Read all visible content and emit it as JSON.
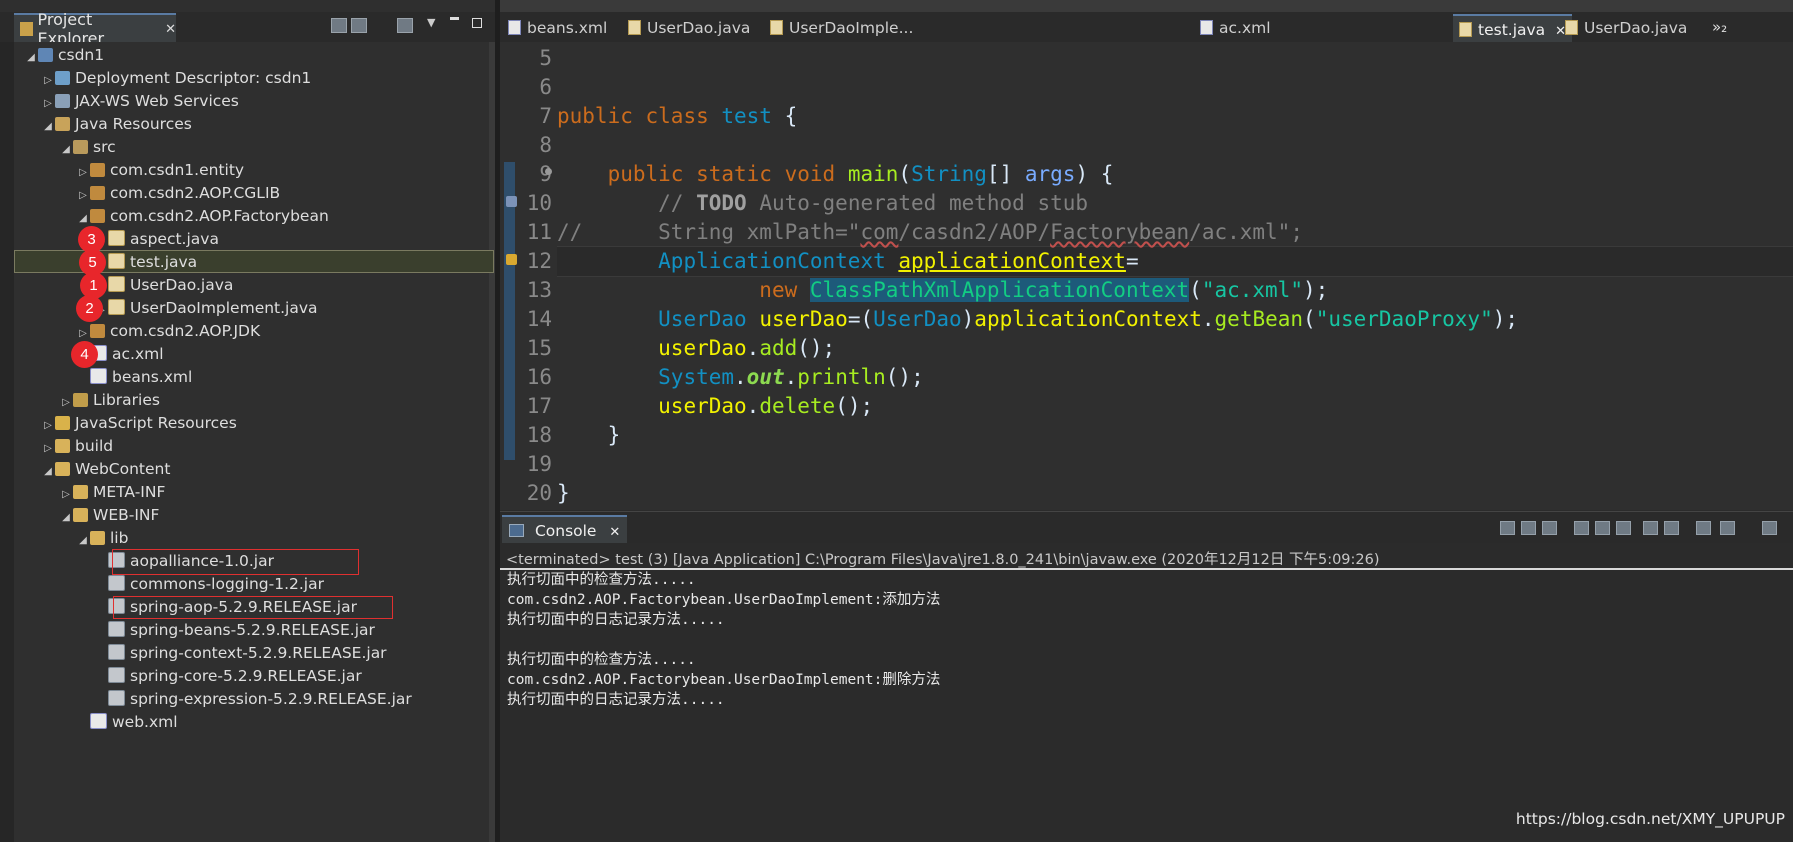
{
  "project_explorer": {
    "tab_label": "Project Explorer",
    "close_glyph": "✕",
    "tree": [
      {
        "label": "csdn1",
        "icon": "project-icon",
        "expand": "open",
        "badge": ""
      },
      {
        "label": "Deployment Descriptor: csdn1",
        "icon": "deployment-descriptor-icon",
        "expand": "closed",
        "badge": ""
      },
      {
        "label": "JAX-WS Web Services",
        "icon": "web-services-icon",
        "expand": "closed",
        "badge": ""
      },
      {
        "label": "Java Resources",
        "icon": "java-resources-icon",
        "expand": "open",
        "badge": ""
      },
      {
        "label": "src",
        "icon": "source-folder-icon",
        "expand": "open",
        "badge": ""
      },
      {
        "label": "com.csdn1.entity",
        "icon": "package-icon",
        "expand": "closed",
        "badge": ""
      },
      {
        "label": "com.csdn2.AOP.CGLIB",
        "icon": "package-icon",
        "expand": "closed",
        "badge": ""
      },
      {
        "label": "com.csdn2.AOP.Factorybean",
        "icon": "package-icon",
        "expand": "open",
        "badge": ""
      },
      {
        "label": "aspect.java",
        "icon": "java-file-icon",
        "expand": "closed",
        "badge": "3"
      },
      {
        "label": "test.java",
        "icon": "java-file-icon",
        "expand": "closed",
        "badge": "5"
      },
      {
        "label": "UserDao.java",
        "icon": "java-file-icon",
        "expand": "none",
        "badge": "1"
      },
      {
        "label": "UserDaoImplement.java",
        "icon": "java-file-icon",
        "expand": "closed",
        "badge": "2"
      },
      {
        "label": "com.csdn2.AOP.JDK",
        "icon": "package-icon",
        "expand": "closed",
        "badge": ""
      },
      {
        "label": "ac.xml",
        "icon": "xml-file-icon",
        "expand": "none",
        "badge": "4"
      },
      {
        "label": "beans.xml",
        "icon": "xml-file-icon",
        "expand": "none",
        "badge": ""
      },
      {
        "label": "Libraries",
        "icon": "libraries-icon",
        "expand": "closed",
        "badge": ""
      },
      {
        "label": "JavaScript Resources",
        "icon": "javascript-resources-icon",
        "expand": "closed",
        "badge": ""
      },
      {
        "label": "build",
        "icon": "folder-icon",
        "expand": "closed",
        "badge": ""
      },
      {
        "label": "WebContent",
        "icon": "folder-icon",
        "expand": "open",
        "badge": ""
      },
      {
        "label": "META-INF",
        "icon": "folder-icon",
        "expand": "closed",
        "badge": ""
      },
      {
        "label": "WEB-INF",
        "icon": "folder-icon",
        "expand": "open",
        "badge": ""
      },
      {
        "label": "lib",
        "icon": "folder-icon",
        "expand": "open",
        "badge": ""
      },
      {
        "label": "aopalliance-1.0.jar",
        "icon": "jar-icon",
        "expand": "none",
        "badge": ""
      },
      {
        "label": "commons-logging-1.2.jar",
        "icon": "jar-icon",
        "expand": "none",
        "badge": ""
      },
      {
        "label": "spring-aop-5.2.9.RELEASE.jar",
        "icon": "jar-icon",
        "expand": "none",
        "badge": ""
      },
      {
        "label": "spring-beans-5.2.9.RELEASE.jar",
        "icon": "jar-icon",
        "expand": "none",
        "badge": ""
      },
      {
        "label": "spring-context-5.2.9.RELEASE.jar",
        "icon": "jar-icon",
        "expand": "none",
        "badge": ""
      },
      {
        "label": "spring-core-5.2.9.RELEASE.jar",
        "icon": "jar-icon",
        "expand": "none",
        "badge": ""
      },
      {
        "label": "spring-expression-5.2.9.RELEASE.jar",
        "icon": "jar-icon",
        "expand": "none",
        "badge": ""
      },
      {
        "label": "web.xml",
        "icon": "xml-file-icon",
        "expand": "none",
        "badge": ""
      }
    ]
  },
  "editor_tabs": [
    {
      "label": "beans.xml",
      "icon": "xml-file-icon"
    },
    {
      "label": "UserDao.java",
      "icon": "java-file-icon"
    },
    {
      "label": "UserDaoImple...",
      "icon": "java-file-icon"
    },
    {
      "label": "ac.xml",
      "icon": "xml-file-icon"
    },
    {
      "label": "test.java",
      "icon": "java-file-icon",
      "active": true
    },
    {
      "label": "UserDao.java",
      "icon": "java-file-icon"
    }
  ],
  "editor_overflow": "»₂",
  "editor": {
    "line_numbers": [
      "5",
      "6",
      "7",
      "8",
      "9",
      "10",
      "11",
      "12",
      "13",
      "14",
      "15",
      "16",
      "17",
      "18",
      "19",
      "20"
    ],
    "lines": [
      [],
      [],
      [
        [
          "kw",
          "public "
        ],
        [
          "kw",
          "class "
        ],
        [
          "ty",
          "test "
        ],
        [
          "",
          "{"
        ]
      ],
      [],
      [
        [
          "",
          "    "
        ],
        [
          "kw",
          "public "
        ],
        [
          "kw",
          "static "
        ],
        [
          "kw",
          "void "
        ],
        [
          "fn",
          "main"
        ],
        [
          "",
          "("
        ],
        [
          "ty",
          "String"
        ],
        [
          "",
          "[] "
        ],
        [
          "lv",
          "args"
        ],
        [
          "",
          ") {"
        ]
      ],
      [
        [
          "",
          "        "
        ],
        [
          "cm",
          "// "
        ],
        [
          "todo",
          "TODO"
        ],
        [
          "cm",
          " Auto-generated method stub"
        ]
      ],
      [
        [
          "cm",
          "//      String xmlPath=\""
        ],
        [
          "cmw",
          "com"
        ],
        [
          "cm",
          "/casdn2/AOP/"
        ],
        [
          "cmw",
          "Factorybean"
        ],
        [
          "cm",
          "/ac.xml\";"
        ]
      ],
      [
        [
          "",
          "        "
        ],
        [
          "ty",
          "ApplicationContext "
        ],
        [
          "varu",
          "applicationContext"
        ],
        [
          "",
          "="
        ]
      ],
      [
        [
          "",
          "                "
        ],
        [
          "kw",
          "new "
        ],
        [
          "clsh",
          "ClassPathXmlApplicationContext"
        ],
        [
          "",
          "("
        ],
        [
          "str",
          "\"ac.xml\""
        ],
        [
          "",
          ");"
        ]
      ],
      [
        [
          "",
          "        "
        ],
        [
          "ty",
          "UserDao "
        ],
        [
          "var",
          "userDao"
        ],
        [
          "",
          "=("
        ],
        [
          "ty",
          "UserDao"
        ],
        [
          "",
          ")"
        ],
        [
          "var",
          "applicationContext"
        ],
        [
          "",
          "."
        ],
        [
          "fn",
          "getBean"
        ],
        [
          "",
          "("
        ],
        [
          "str",
          "\"userDaoProxy\""
        ],
        [
          "",
          ");"
        ]
      ],
      [
        [
          "",
          "        "
        ],
        [
          "var",
          "userDao"
        ],
        [
          "",
          "."
        ],
        [
          "fn",
          "add"
        ],
        [
          "",
          "();"
        ]
      ],
      [
        [
          "",
          "        "
        ],
        [
          "ty",
          "System"
        ],
        [
          "",
          "."
        ],
        [
          "st",
          "out"
        ],
        [
          "",
          "."
        ],
        [
          "fn",
          "println"
        ],
        [
          "",
          "();"
        ]
      ],
      [
        [
          "",
          "        "
        ],
        [
          "var",
          "userDao"
        ],
        [
          "",
          "."
        ],
        [
          "fn",
          "delete"
        ],
        [
          "",
          "();"
        ]
      ],
      [
        [
          "",
          "    "
        ],
        [
          "",
          "}"
        ]
      ],
      [],
      [
        [
          "",
          "}"
        ]
      ]
    ]
  },
  "console": {
    "tab_label": "Console",
    "close_glyph": "✕",
    "terminated": "<terminated> test (3) [Java Application] C:\\Program Files\\Java\\jre1.8.0_241\\bin\\javaw.exe (2020年12月12日 下午5:09:26)",
    "output": [
      "执行切面中的检查方法.....",
      "com.csdn2.AOP.Factorybean.UserDaoImplement:添加方法",
      "执行切面中的日志记录方法.....",
      "",
      "执行切面中的检查方法.....",
      "com.csdn2.AOP.Factorybean.UserDaoImplement:删除方法",
      "执行切面中的日志记录方法....."
    ]
  },
  "watermark": "https://blog.csdn.net/XMY_UPUPUP",
  "colors": {
    "keyword": "#cc6c1d",
    "type": "#1290c3",
    "method": "#a7ec21",
    "field": "#f2f200",
    "string": "#17c6a3",
    "comment": "#808080",
    "badge_red": "#e8262b"
  }
}
